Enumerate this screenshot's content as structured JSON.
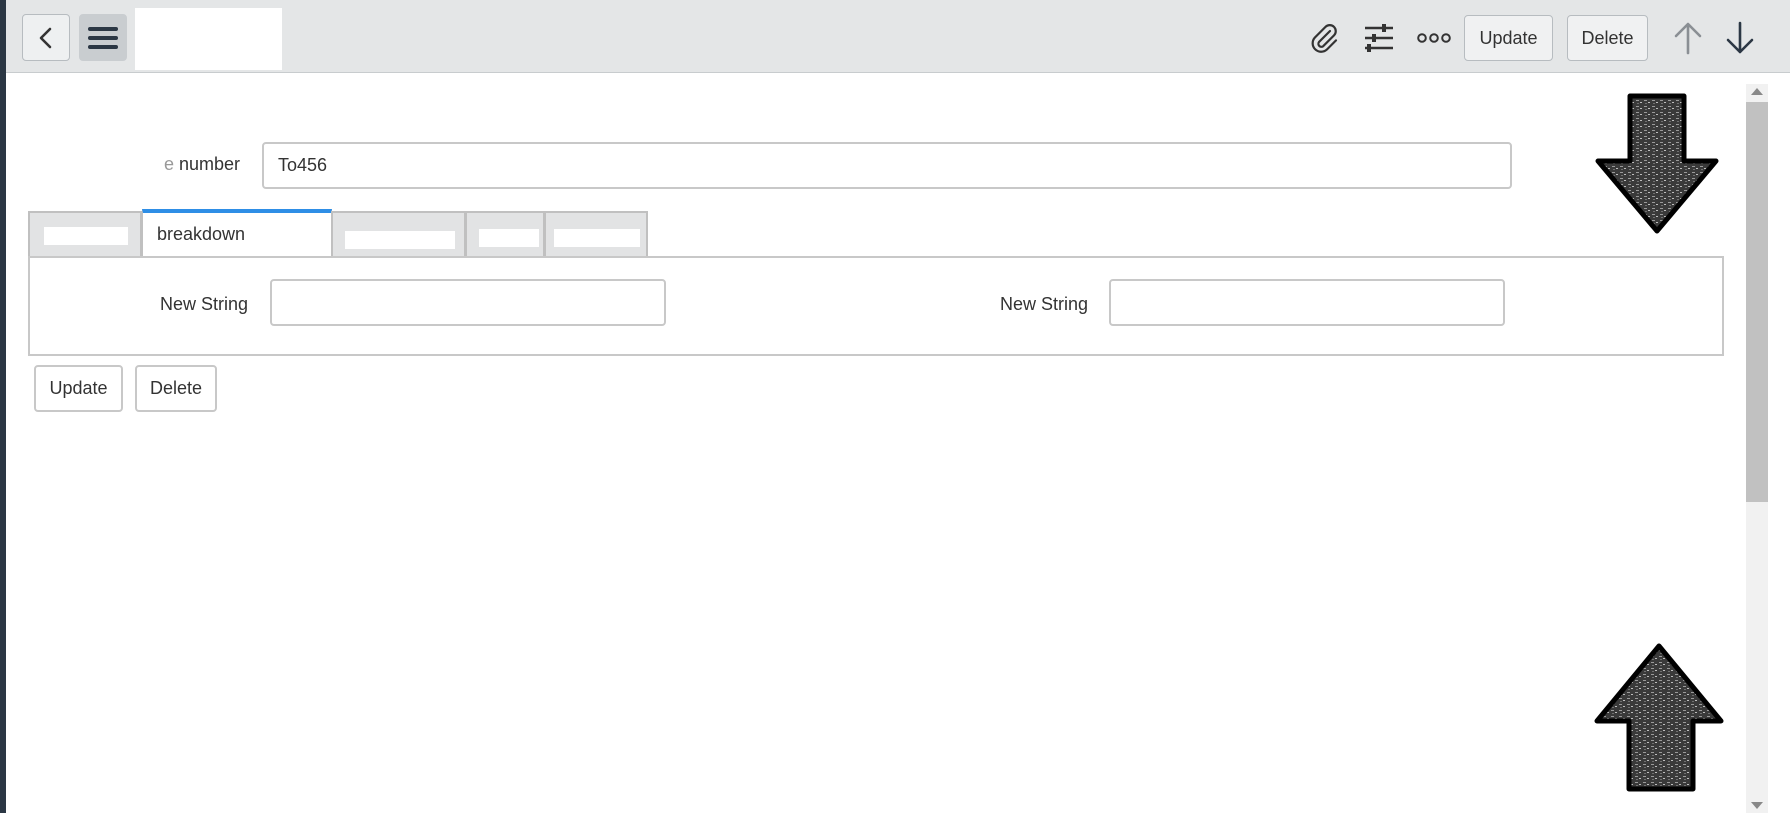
{
  "toolbar": {
    "back_icon": "chevron-left-icon",
    "menu_icon": "hamburger-menu-icon",
    "attach_icon": "paperclip-icon",
    "settings_icon": "sliders-icon",
    "more_icon": "more-options-icon",
    "update_label": "Update",
    "delete_label": "Delete",
    "up_icon": "arrow-up-icon",
    "down_icon": "arrow-down-icon"
  },
  "form": {
    "number_label": "number",
    "number_value": "To456",
    "tabs": [
      {
        "label": "",
        "active": false
      },
      {
        "label": "breakdown",
        "active": true
      },
      {
        "label": "",
        "active": false
      },
      {
        "label": "",
        "active": false
      },
      {
        "label": "",
        "active": false
      }
    ],
    "fields": [
      {
        "label": "New String",
        "value": ""
      },
      {
        "label": "New String",
        "value": ""
      }
    ],
    "update_label": "Update",
    "delete_label": "Delete"
  },
  "overlay": {
    "scroll_down_arrow": "large-down-arrow-icon",
    "scroll_up_arrow": "large-up-arrow-icon"
  },
  "colors": {
    "accent": "#2e8ee6",
    "topbar_bg": "#e4e6e7",
    "sidebar_edge": "#2b3744"
  }
}
